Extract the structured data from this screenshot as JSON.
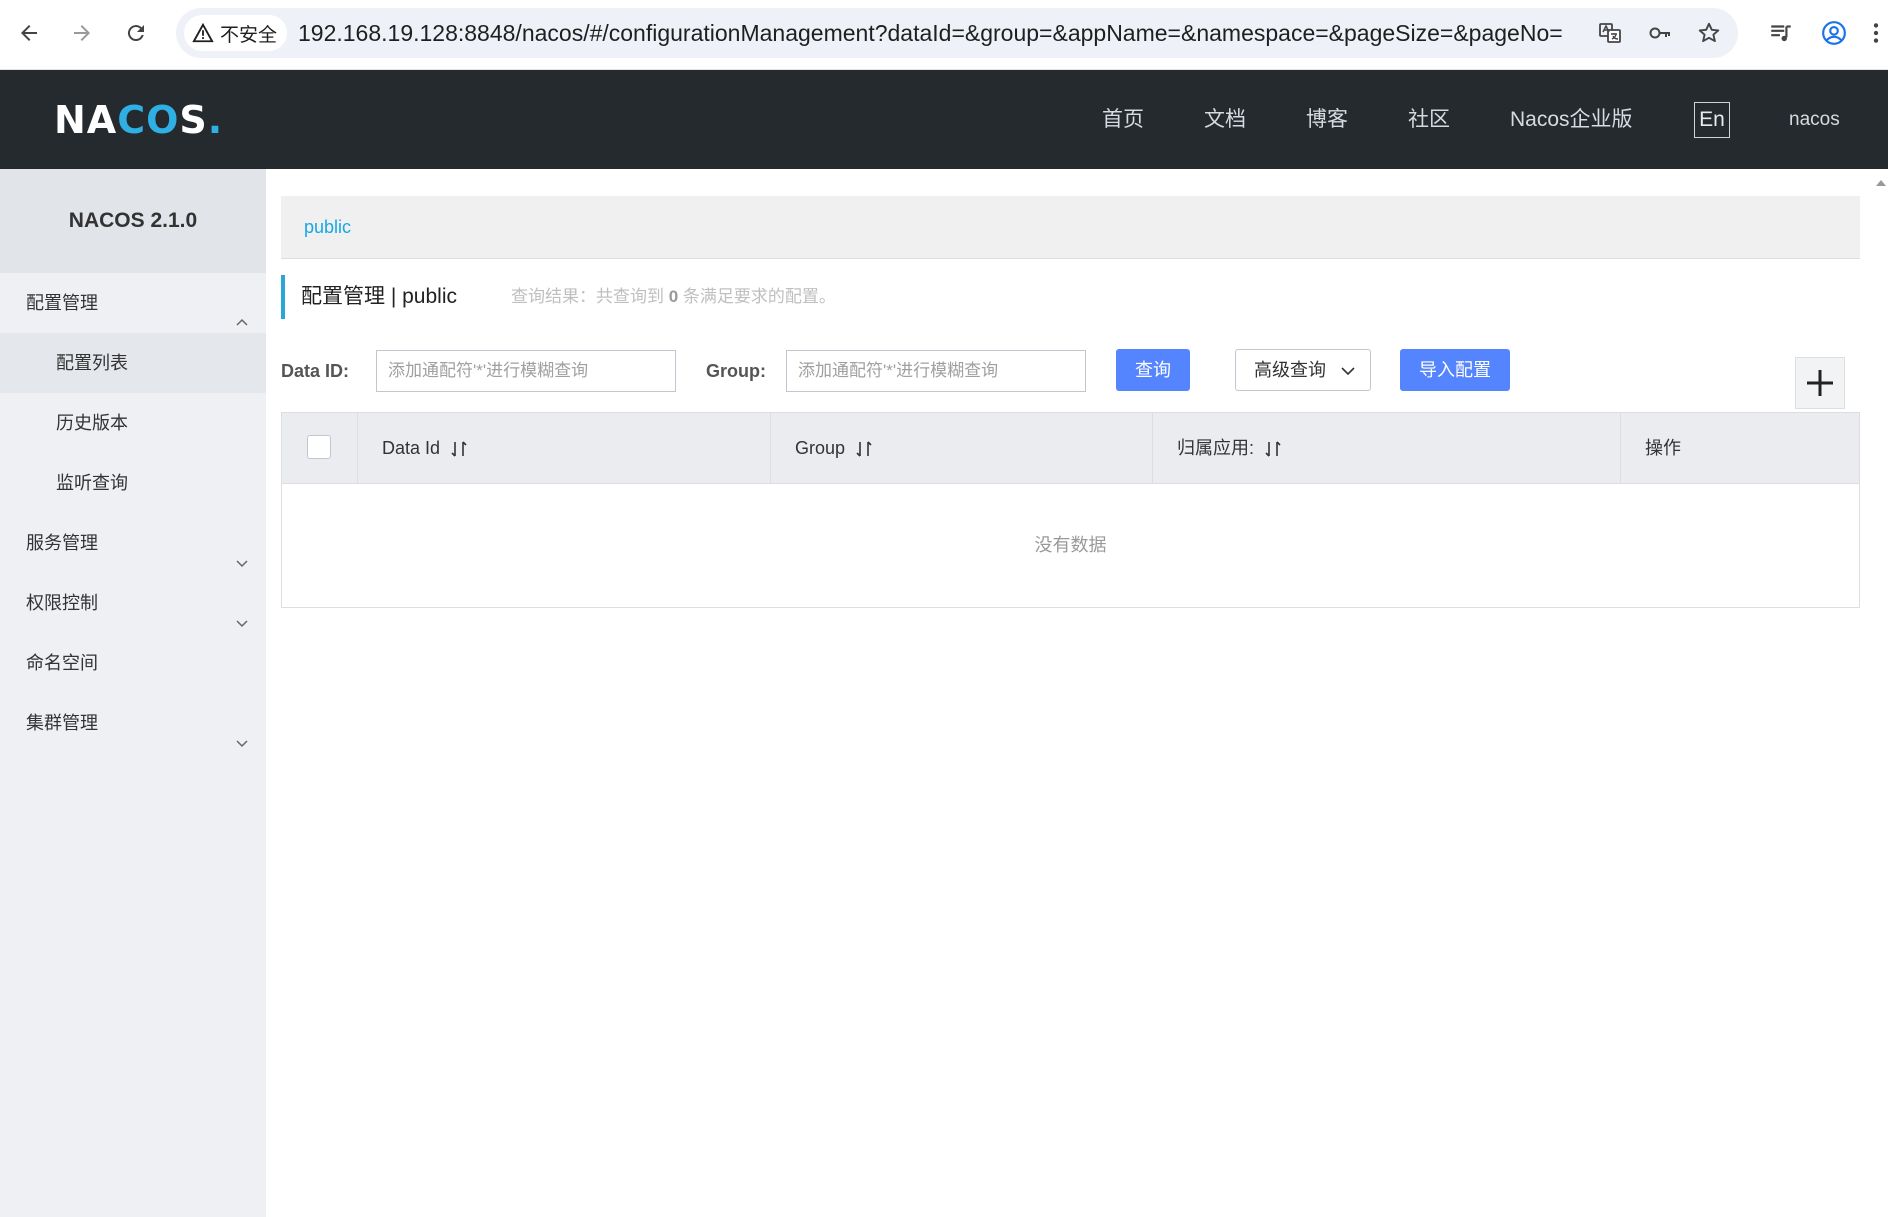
{
  "browser": {
    "security_label": "不安全",
    "url": "192.168.19.128:8848/nacos/#/configurationManagement?dataId=&group=&appName=&namespace=&pageSize=&pageNo="
  },
  "header": {
    "logo": {
      "na": "NA",
      "co": "CO",
      "s": "S",
      "dot": "."
    },
    "nav": [
      "首页",
      "文档",
      "博客",
      "社区",
      "Nacos企业版"
    ],
    "lang": "En",
    "user": "nacos"
  },
  "sidebar": {
    "title": "NACOS 2.1.0",
    "items": [
      {
        "label": "配置管理",
        "expanded": true
      },
      {
        "label": "配置列表",
        "active": true
      },
      {
        "label": "历史版本"
      },
      {
        "label": "监听查询"
      },
      {
        "label": "服务管理",
        "expanded": false
      },
      {
        "label": "权限控制",
        "expanded": false
      },
      {
        "label": "命名空间"
      },
      {
        "label": "集群管理",
        "expanded": false
      }
    ]
  },
  "main": {
    "namespace_link": "public",
    "title": "配置管理  |  public",
    "result_prefix": "查询结果：共查询到 ",
    "result_count": "0",
    "result_suffix": " 条满足要求的配置。",
    "filters": {
      "data_id_label": "Data ID:",
      "data_id_placeholder": "添加通配符'*'进行模糊查询",
      "group_label": "Group:",
      "group_placeholder": "添加通配符'*'进行模糊查询",
      "query_button": "查询",
      "advanced_query": "高级查询",
      "import_button": "导入配置"
    },
    "table": {
      "columns": [
        "Data Id",
        "Group",
        "归属应用:",
        "操作"
      ],
      "empty_text": "没有数据"
    }
  },
  "colors": {
    "topbar": "#252a2f",
    "accent": "#5584ff",
    "link": "#17a8e3",
    "sidebar_bg": "#eef0f4"
  }
}
